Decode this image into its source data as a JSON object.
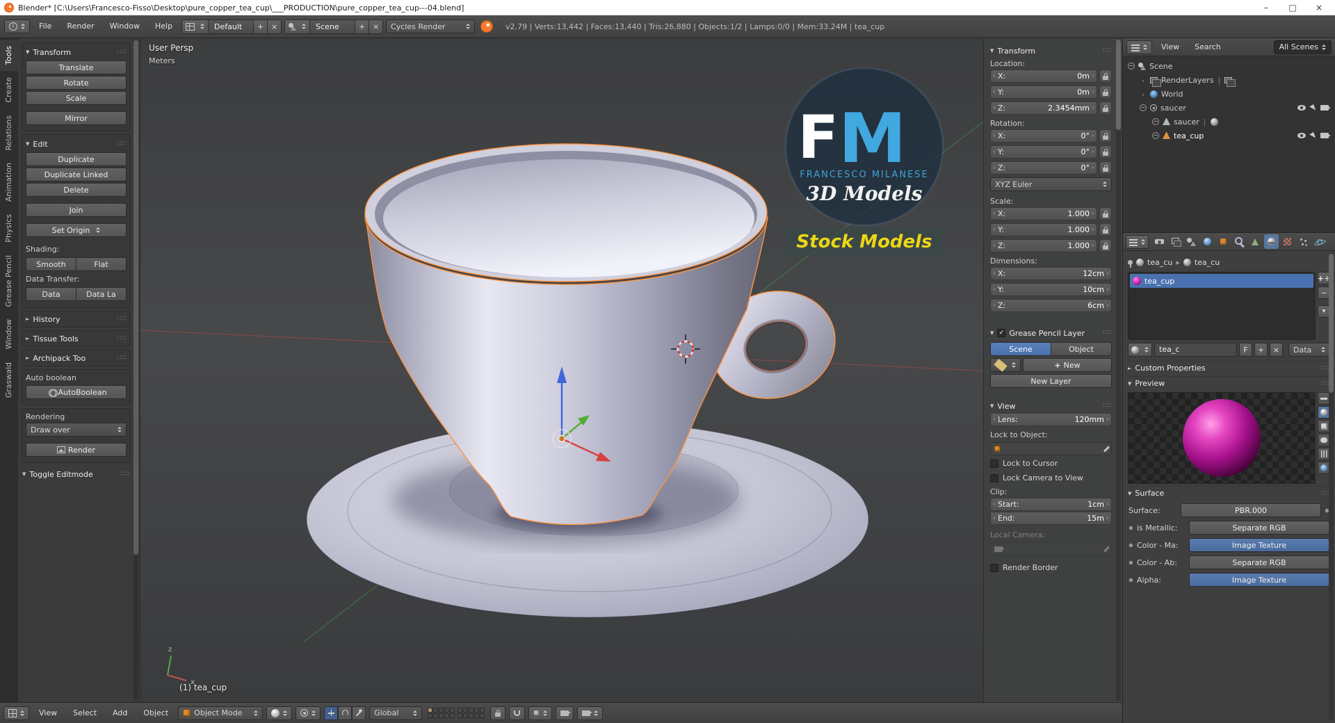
{
  "titlebar": {
    "title": "Blender* [C:\\Users\\Francesco-Fisso\\Desktop\\pure_copper_tea_cup\\___PRODUCTION\\pure_copper_tea_cup---04.blend]",
    "minimize": "–",
    "maximize": "□",
    "close": "×"
  },
  "topbar": {
    "menu_file": "File",
    "menu_render": "Render",
    "menu_window": "Window",
    "menu_help": "Help",
    "layout_value": "Default",
    "scene_value": "Scene",
    "engine_value": "Cycles Render",
    "stats": "v2.79 | Verts:13,442 | Faces:13,440 | Tris:26,880 | Objects:1/2 | Lamps:0/0 | Mem:33.24M | tea_cup"
  },
  "tabs": [
    "Tools",
    "Create",
    "Relations",
    "Animation",
    "Physics",
    "Grease Pencil",
    "Window",
    "Graswald"
  ],
  "toolshelf": {
    "transform_header": "Transform",
    "translate": "Translate",
    "rotate": "Rotate",
    "scale": "Scale",
    "mirror": "Mirror",
    "edit_header": "Edit",
    "duplicate": "Duplicate",
    "duplicate_linked": "Duplicate Linked",
    "delete": "Delete",
    "join": "Join",
    "set_origin": "Set Origin",
    "shading_label": "Shading:",
    "smooth": "Smooth",
    "flat": "Flat",
    "data_transfer_label": "Data Transfer:",
    "data": "Data",
    "data_layout": "Data La",
    "history_header": "History",
    "tissue_header": "Tissue Tools",
    "archipack_header": "Archipack Too",
    "auto_boolean_label": "Auto boolean",
    "auto_boolean_button": "AutoBoolean",
    "rendering_label": "Rendering",
    "draw_over": "Draw over",
    "render_button": "Render",
    "toggle_editmode": "Toggle Editmode"
  },
  "viewport": {
    "view_label": "User Persp",
    "unit_label": "Meters",
    "object_label": "(1) tea_cup",
    "axis_x": "x",
    "axis_z": "z",
    "watermark": {
      "f": "F",
      "m": "M",
      "name": "FRANCESCO MILANESE",
      "models": "3D Models",
      "stock": "Stock Models"
    }
  },
  "npanel": {
    "transform_header": "Transform",
    "location_label": "Location:",
    "loc_x_label": "X:",
    "loc_x": "0m",
    "loc_y_label": "Y:",
    "loc_y": "0m",
    "loc_z_label": "Z:",
    "loc_z": "2.3454mm",
    "rotation_label": "Rotation:",
    "rot_x_label": "X:",
    "rot_x": "0°",
    "rot_y_label": "Y:",
    "rot_y": "0°",
    "rot_z_label": "Z:",
    "rot_z": "0°",
    "rotation_mode": "XYZ Euler",
    "scale_label": "Scale:",
    "scale_x_label": "X:",
    "scale_x": "1.000",
    "scale_y_label": "Y:",
    "scale_y": "1.000",
    "scale_z_label": "Z:",
    "scale_z": "1.000",
    "dimensions_label": "Dimensions:",
    "dim_x_label": "X:",
    "dim_x": "12cm",
    "dim_y_label": "Y:",
    "dim_y": "10cm",
    "dim_z_label": "Z:",
    "dim_z": "6cm",
    "gp_header": "Grease Pencil Layer",
    "gp_scene": "Scene",
    "gp_object": "Object",
    "gp_new": "New",
    "gp_new_layer": "New Layer",
    "view_header": "View",
    "lens_label": "Lens:",
    "lens_value": "120mm",
    "lock_to_object": "Lock to Object:",
    "lock_to_cursor": "Lock to Cursor",
    "lock_camera": "Lock Camera to View",
    "clip_label": "Clip:",
    "clip_start_label": "Start:",
    "clip_start": "1cm",
    "clip_end_label": "End:",
    "clip_end": "15m",
    "local_camera_label": "Local Camera:",
    "render_border": "Render Border"
  },
  "outliner": {
    "menu_view": "View",
    "menu_search": "Search",
    "display_mode": "All Scenes",
    "scene": "Scene",
    "renderlayers": "RenderLayers",
    "world": "World",
    "saucer_group": "saucer",
    "saucer_mesh": "saucer",
    "tea_cup": "tea_cup"
  },
  "properties": {
    "breadcrumb_a": "tea_cu",
    "breadcrumb_b": "tea_cu",
    "slot_name": "tea_cup",
    "mat_name": "tea_c",
    "fake_user": "F",
    "link_mode": "Data",
    "custom_props_header": "Custom Properties",
    "preview_header": "Preview",
    "surface_header": "Surface",
    "surface_label": "Surface:",
    "surface_value": "PBR.000",
    "metallic_label": "is Metallic:",
    "metallic_value": "Separate RGB",
    "color_ma_label": "Color - Ma:",
    "color_ma_value": "Image Texture",
    "color_ab_label": "Color - Ab:",
    "color_ab_value": "Separate RGB",
    "alpha_label": "Alpha:",
    "alpha_value": "Image Texture"
  },
  "bottombar": {
    "menu_view": "View",
    "menu_select": "Select",
    "menu_add": "Add",
    "menu_object": "Object",
    "mode_value": "Object Mode",
    "orientation_value": "Global"
  }
}
